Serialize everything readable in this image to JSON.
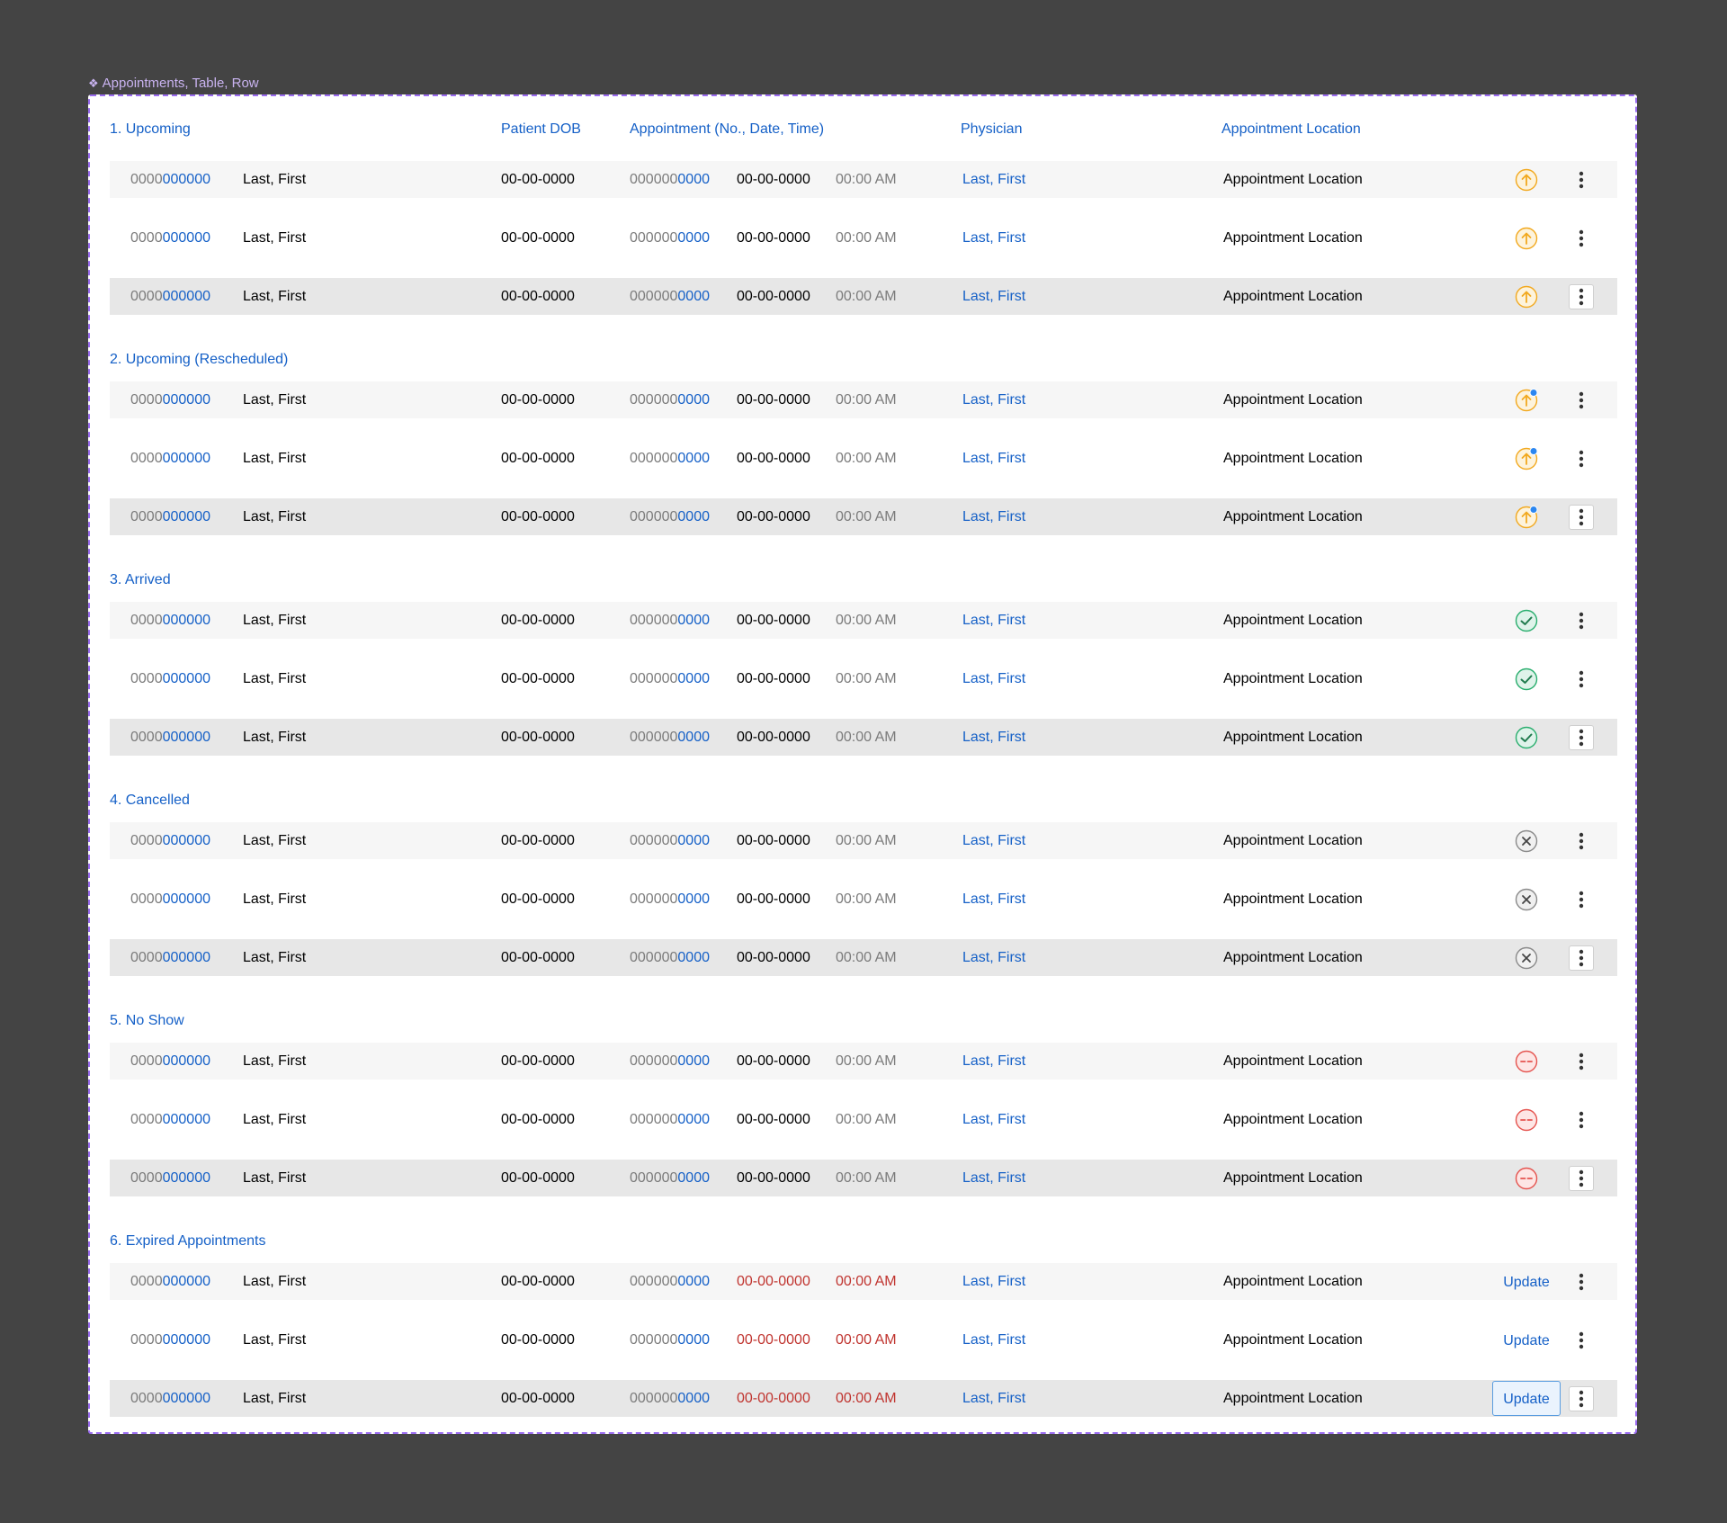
{
  "frame_label": "Appointments, Table, Row",
  "header": {
    "group_1_title": "1. Upcoming",
    "patient_dob": "Patient DOB",
    "appointment": "Appointment (No., Date, Time)",
    "physician": "Physician",
    "location": "Appointment Location"
  },
  "groups": [
    {
      "title": "1. Upcoming",
      "status": "upcoming"
    },
    {
      "title": "2. Upcoming (Rescheduled)",
      "status": "rescheduled"
    },
    {
      "title": "3. Arrived",
      "status": "arrived"
    },
    {
      "title": "4. Cancelled",
      "status": "cancelled"
    },
    {
      "title": "5. No Show",
      "status": "no-show"
    },
    {
      "title": "6. Expired Appointments",
      "status": "expired"
    }
  ],
  "row": {
    "patient_no_prefix": "0000",
    "patient_no_suffix": "000000",
    "patient_name": "Last, First",
    "dob": "00-00-0000",
    "appt_no_prefix": "000000",
    "appt_no_suffix": "0000",
    "appt_date": "00-00-0000",
    "appt_time": "00:00 AM",
    "physician": "Last, First",
    "location": "Appointment Location",
    "update_label": "Update"
  },
  "colors": {
    "accent_blue": "#1560c7",
    "upcoming": "#f2a91f",
    "rescheduled_dot": "#2b86f0",
    "arrived": "#2aae6e",
    "cancelled": "#8a8a8a",
    "no_show": "#e5544f",
    "expired_red": "#c0342f"
  }
}
